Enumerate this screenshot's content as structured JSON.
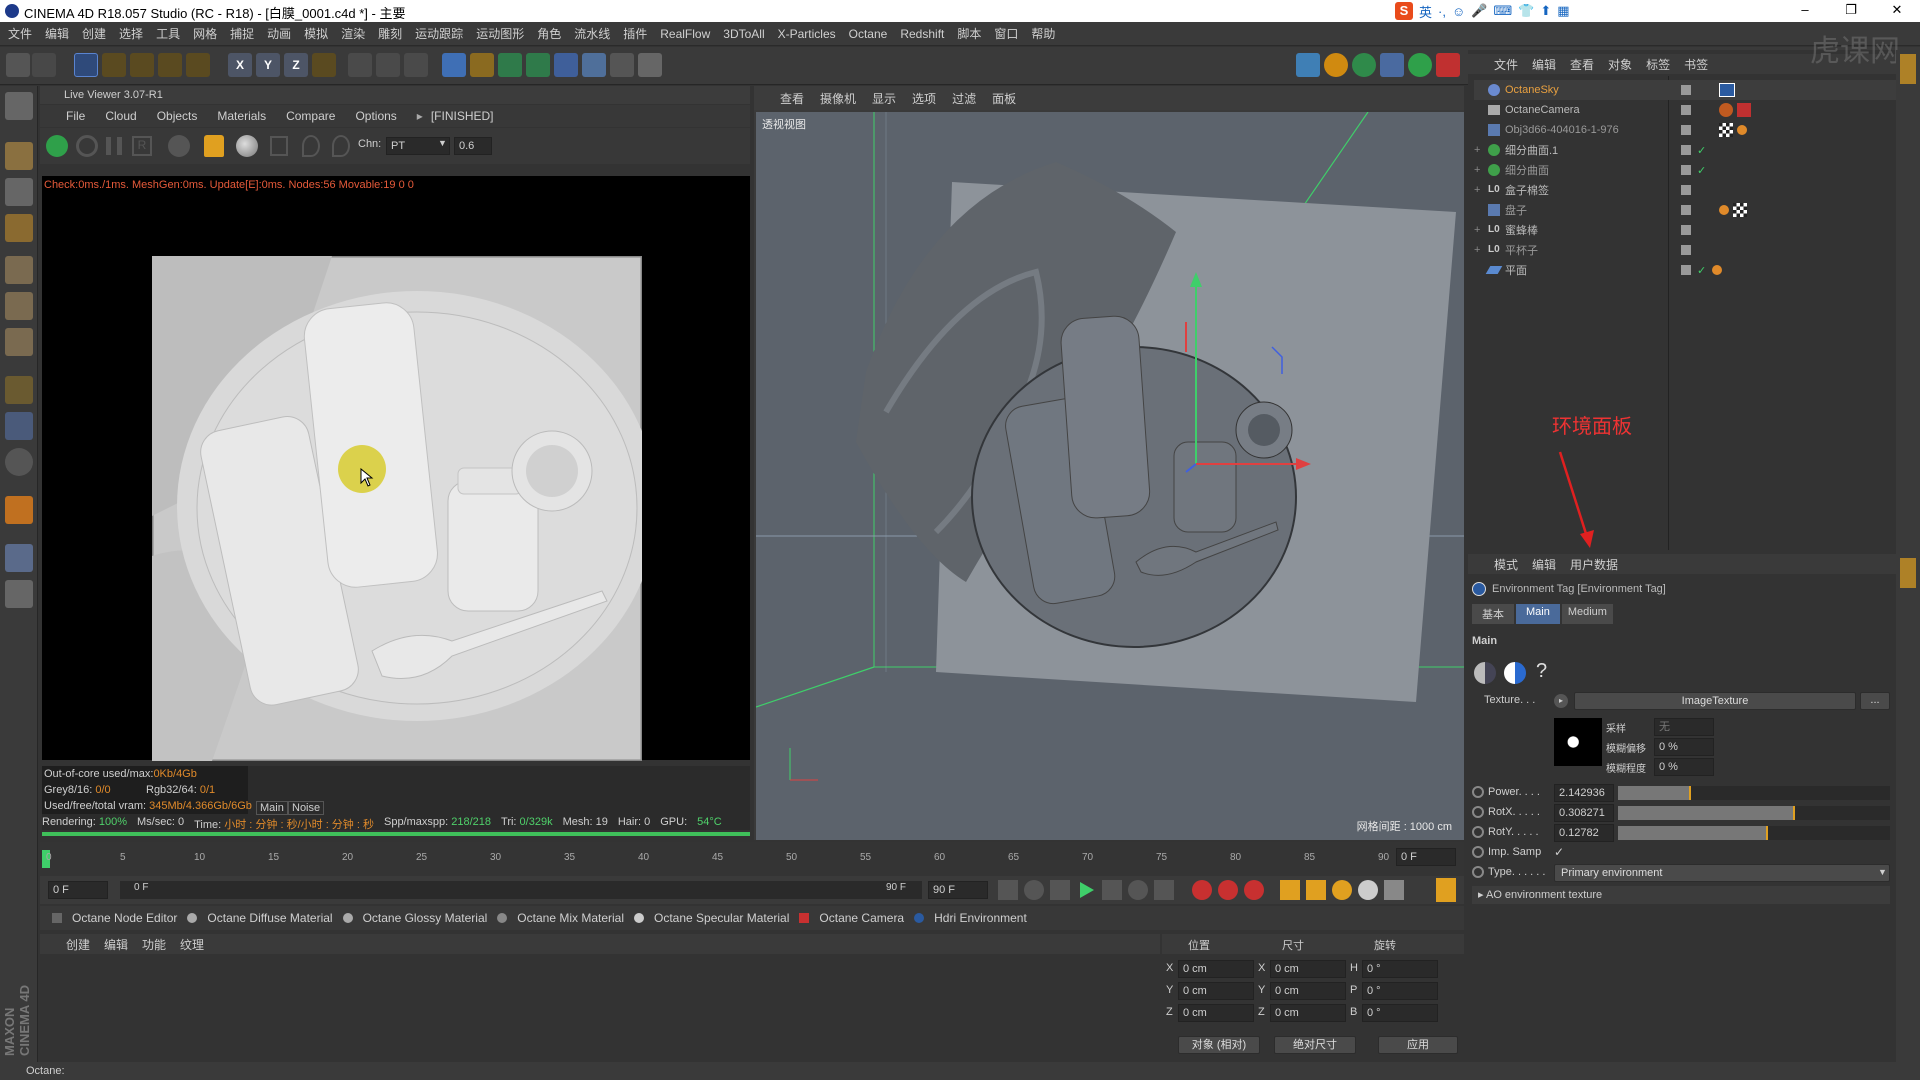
{
  "window": {
    "title": "CINEMA 4D R18.057 Studio (RC - R18) - [白膜_0001.c4d *] - 主要",
    "controls": [
      "–",
      "❐",
      "✕"
    ],
    "ime": [
      "S",
      "英",
      "·,",
      "☺",
      "🎤",
      "⌨",
      "👕",
      "⬆",
      "▦"
    ]
  },
  "menu": [
    "文件",
    "编辑",
    "创建",
    "选择",
    "工具",
    "网格",
    "捕捉",
    "动画",
    "模拟",
    "渲染",
    "雕刻",
    "运动跟踪",
    "运动图形",
    "角色",
    "流水线",
    "插件",
    "RealFlow",
    "3DToAll",
    "X-Particles",
    "Octane",
    "Redshift",
    "脚本",
    "窗口",
    "帮助"
  ],
  "toolbar": {
    "axes": [
      "X",
      "Y",
      "Z"
    ]
  },
  "live_viewer": {
    "title": "Live Viewer 3.07-R1",
    "menu": [
      "File",
      "Cloud",
      "Objects",
      "Materials",
      "Compare",
      "Options"
    ],
    "state": "[FINISHED]",
    "chn_label": "Chn:",
    "chn_value": "PT",
    "chn_num": "0.6",
    "check_line": "Check:0ms./1ms. MeshGen:0ms. Update[E]:0ms. Nodes:56 Movable:19  0 0",
    "out_of_core": "Out-of-core used/max:",
    "out_of_core_val": "0Kb/4Gb",
    "grey": "Grey8/16: ",
    "grey_val": "0/0",
    "rgb": "Rgb32/64: ",
    "rgb_val": "0/1",
    "vram": "Used/free/total vram: ",
    "vram_val": "345Mb/4.366Gb/6Gb",
    "tab_main": "Main",
    "tab_noise": "Noise",
    "rendering_label": "Rendering: ",
    "rendering_val": "100%",
    "ms_label": "Ms/sec: 0",
    "time_label": "Time: ",
    "time_val": "小时 : 分钟 : 秒/小时 : 分钟 : 秒",
    "spp_label": "Spp/maxspp: ",
    "spp_val": "218/218",
    "tri_label": "Tri: ",
    "tri_val": "0/329k",
    "mesh": "Mesh: 19",
    "hair": "Hair: 0",
    "gpu_label": "GPU:",
    "gpu_temp": "54°C",
    "progress": 1.0
  },
  "viewport": {
    "menu": [
      "查看",
      "摄像机",
      "显示",
      "选项",
      "过滤",
      "面板"
    ],
    "label": "透视视图",
    "grid_distance": "网格间距 : 1000 cm"
  },
  "object_manager": {
    "menu": [
      "文件",
      "编辑",
      "查看",
      "对象",
      "标签",
      "书签"
    ],
    "objects": [
      {
        "name": "OctaneSky",
        "color": "#e8a040",
        "expand": ""
      },
      {
        "name": "OctaneCamera",
        "color": "#bbbbbb",
        "expand": ""
      },
      {
        "name": "Obj3d66-404016-1-976",
        "color": "#999999",
        "expand": ""
      },
      {
        "name": "细分曲面.1",
        "color": "#bbbbbb",
        "expand": "+"
      },
      {
        "name": "细分曲面",
        "color": "#999999",
        "expand": "+"
      },
      {
        "name": "盒子棉签",
        "color": "#bbbbbb",
        "expand": "+"
      },
      {
        "name": "盘子",
        "color": "#999999",
        "expand": ""
      },
      {
        "name": "蜜蜂棒",
        "color": "#bbbbbb",
        "expand": "+"
      },
      {
        "name": "平杯子",
        "color": "#999999",
        "expand": "+"
      },
      {
        "name": "平面",
        "color": "#bbbbbb",
        "expand": ""
      }
    ],
    "annotation": "环境面板"
  },
  "attribute_manager": {
    "menu": [
      "模式",
      "编辑",
      "用户数据"
    ],
    "title": "Environment Tag [Environment Tag]",
    "tabs": [
      "基本",
      "Main",
      "Medium"
    ],
    "section": "Main",
    "texture_label": "Texture. . .",
    "texture_value": "ImageTexture",
    "texture_btn": "...",
    "sample_label": "采样",
    "sample_value": "无",
    "blur_offset_label": "模糊偏移",
    "blur_offset_value": "0 %",
    "blur_degree_label": "模糊程度",
    "blur_degree_value": "0 %",
    "params": [
      {
        "label": "Power. . . .",
        "value": "2.142936",
        "fill": 0.27
      },
      {
        "label": "RotX. . . . .",
        "value": "0.308271",
        "fill": 0.65
      },
      {
        "label": "RotY. . . . .",
        "value": "0.12782",
        "fill": 0.55
      }
    ],
    "imp_label": "Imp. Samp",
    "imp_value": "✓",
    "type_label": "Type. . . . . .",
    "type_value": "Primary environment",
    "ao_label": "AO environment texture"
  },
  "timeline": {
    "ticks": [
      "0",
      "5",
      "10",
      "15",
      "20",
      "25",
      "30",
      "35",
      "40",
      "45",
      "50",
      "55",
      "60",
      "65",
      "70",
      "75",
      "80",
      "85",
      "90"
    ],
    "end_frame": "0 F",
    "start_field": "0 F",
    "start_field2": "0 F",
    "end_field2": "90 F",
    "end_field3": "90 F"
  },
  "material_bar": [
    "Octane Node Editor",
    "Octane Diffuse Material",
    "Octane Glossy Material",
    "Octane Mix Material",
    "Octane Specular Material",
    "Octane Camera",
    "Hdri Environment"
  ],
  "material_manager": {
    "menu": [
      "创建",
      "编辑",
      "功能",
      "纹理"
    ]
  },
  "coordinates": {
    "headers": [
      "位置",
      "尺寸",
      "旋转"
    ],
    "rows": [
      {
        "a": "X",
        "av": "0 cm",
        "b": "X",
        "bv": "0 cm",
        "c": "H",
        "cv": "0 °"
      },
      {
        "a": "Y",
        "av": "0 cm",
        "b": "Y",
        "bv": "0 cm",
        "c": "P",
        "cv": "0 °"
      },
      {
        "a": "Z",
        "av": "0 cm",
        "b": "Z",
        "bv": "0 cm",
        "c": "B",
        "cv": "0 °"
      }
    ],
    "mode1": "对象 (相对)",
    "mode2": "绝对尺寸",
    "apply": "应用"
  },
  "status": "Octane:",
  "branding": "MAXON CINEMA 4D",
  "watermark": "虎课网"
}
